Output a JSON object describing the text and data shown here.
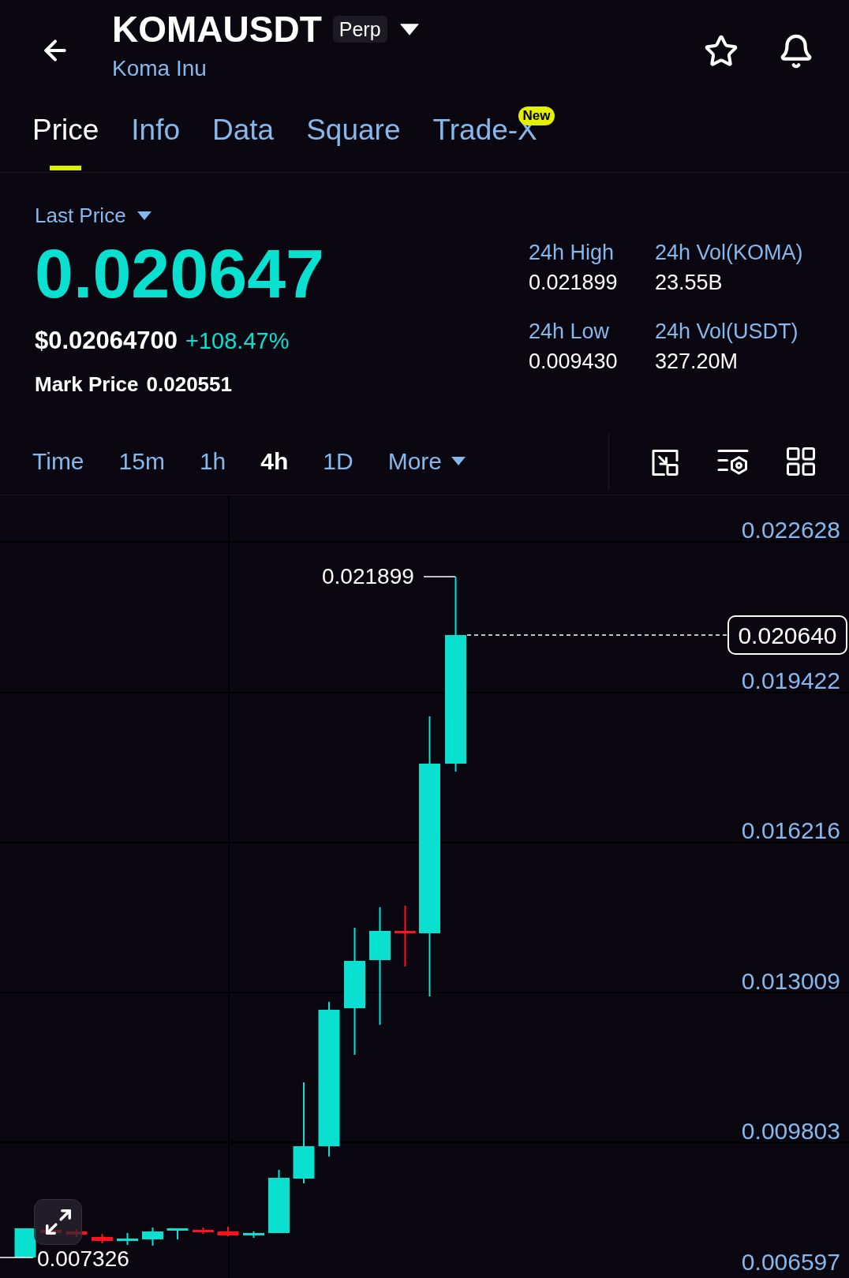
{
  "header": {
    "symbol": "KOMAUSDT",
    "contract_type": "Perp",
    "name": "Koma Inu"
  },
  "tabs": [
    {
      "label": "Price",
      "selected": true
    },
    {
      "label": "Info",
      "selected": false
    },
    {
      "label": "Data",
      "selected": false
    },
    {
      "label": "Square",
      "selected": false
    },
    {
      "label": "Trade-X",
      "selected": false,
      "badge": "New"
    }
  ],
  "price_panel": {
    "selector": "Last Price",
    "last_price": "0.020647",
    "usd_price": "$0.02064700",
    "change": "+108.47%",
    "mark_price_label": "Mark Price",
    "mark_price": "0.020551"
  },
  "stats": [
    {
      "label": "24h High",
      "value": "0.021899"
    },
    {
      "label": "24h Vol(KOMA)",
      "value": "23.55B"
    },
    {
      "label": "24h Low",
      "value": "0.009430"
    },
    {
      "label": "24h Vol(USDT)",
      "value": "327.20M"
    }
  ],
  "intervals": [
    {
      "label": "Time",
      "selected": false,
      "kind": "option"
    },
    {
      "label": "15m",
      "selected": false,
      "kind": "option"
    },
    {
      "label": "1h",
      "selected": false,
      "kind": "option"
    },
    {
      "label": "4h",
      "selected": true,
      "kind": "option"
    },
    {
      "label": "1D",
      "selected": false,
      "kind": "option"
    },
    {
      "label": "More",
      "selected": false,
      "kind": "dropdown"
    }
  ],
  "chart": {
    "y_axis_labels": [
      "0.022628",
      "0.019422",
      "0.016216",
      "0.013009",
      "0.009803",
      "0.006597"
    ],
    "high_marker": "0.021899",
    "current_price": "0.020640",
    "low_marker": "0.007326"
  }
}
